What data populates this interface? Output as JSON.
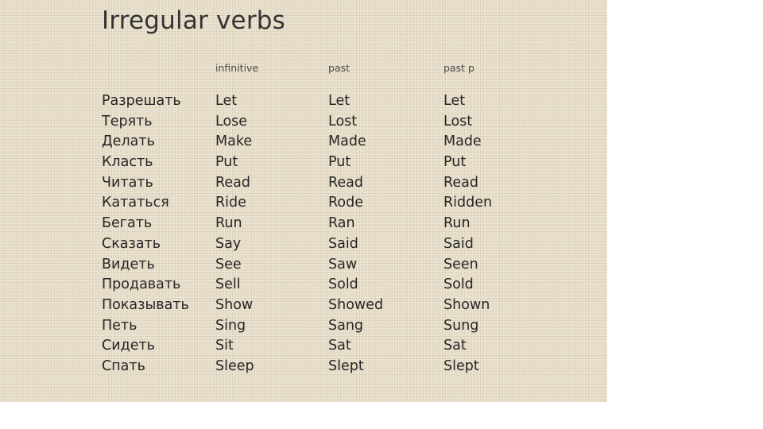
{
  "slide": {
    "title": "Irregular verbs",
    "background_color": "#e6dcc6",
    "text_color": "#262626",
    "header_color": "#4a4a4a"
  },
  "table": {
    "headers": {
      "russian": "",
      "infinitive": "infinitive",
      "past": "past",
      "past_participle": "past p"
    },
    "rows": [
      {
        "russian": "Разрешать",
        "infinitive": "Let",
        "past": "Let",
        "past_participle": "Let"
      },
      {
        "russian": "Терять",
        "infinitive": "Lose",
        "past": "Lost",
        "past_participle": "Lost"
      },
      {
        "russian": "Делать",
        "infinitive": "Make",
        "past": "Made",
        "past_participle": "Made"
      },
      {
        "russian": "Класть",
        "infinitive": "Put",
        "past": "Put",
        "past_participle": "Put"
      },
      {
        "russian": "Читать",
        "infinitive": "Read",
        "past": "Read",
        "past_participle": "Read"
      },
      {
        "russian": "Кататься",
        "infinitive": "Ride",
        "past": "Rode",
        "past_participle": "Ridden"
      },
      {
        "russian": "Бегать",
        "infinitive": "Run",
        "past": "Ran",
        "past_participle": "Run"
      },
      {
        "russian": "Сказать",
        "infinitive": "Say",
        "past": "Said",
        "past_participle": "Said"
      },
      {
        "russian": "Видеть",
        "infinitive": "See",
        "past": "Saw",
        "past_participle": "Seen"
      },
      {
        "russian": "Продавать",
        "infinitive": "Sell",
        "past": "Sold",
        "past_participle": "Sold"
      },
      {
        "russian": "Показывать",
        "infinitive": "Show",
        "past": "Showed",
        "past_participle": "Shown"
      },
      {
        "russian": "Петь",
        "infinitive": "Sing",
        "past": "Sang",
        "past_participle": "Sung"
      },
      {
        "russian": "Сидеть",
        "infinitive": "Sit",
        "past": "Sat",
        "past_participle": "Sat"
      },
      {
        "russian": "Спать",
        "infinitive": "Sleep",
        "past": "Slept",
        "past_participle": "Slept"
      }
    ]
  }
}
